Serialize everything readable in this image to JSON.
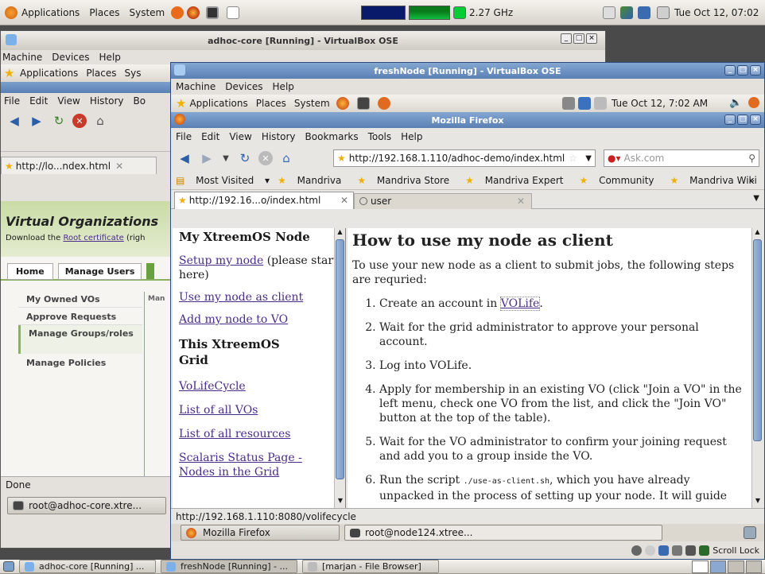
{
  "top_panel": {
    "applications": "Applications",
    "places": "Places",
    "system": "System",
    "cpu_freq": "2.27 GHz",
    "clock": "Tue Oct 12, 07:02"
  },
  "back_window": {
    "title": "adhoc-core [Running] - VirtualBox OSE",
    "menu": [
      "Machine",
      "Devices",
      "Help"
    ],
    "guest_panel": {
      "applications": "Applications",
      "places": "Places",
      "system": "Sys"
    },
    "ff_menu": [
      "File",
      "Edit",
      "View",
      "History",
      "Bo"
    ],
    "tab_label": "http://lo...ndex.html",
    "heading": "Virtual Organizations",
    "download_text": "Download the ",
    "root_cert_link": "Root certificate",
    "download_suffix": " (righ",
    "tabs": [
      "Home",
      "Manage Users"
    ],
    "sidebar": [
      "My Owned VOs",
      "Approve Requests",
      "Manage Groups/roles",
      "Manage Policies"
    ],
    "col_header": "Man",
    "status": "Done",
    "terminal_task": "root@adhoc-core.xtre..."
  },
  "front_window": {
    "title": "freshNode [Running] - VirtualBox OSE",
    "menu": [
      "Machine",
      "Devices",
      "Help"
    ],
    "guest_panel": {
      "applications": "Applications",
      "places": "Places",
      "system": "System",
      "clock": "Tue Oct 12,  7:02 AM"
    },
    "firefox": {
      "title": "Mozilla Firefox",
      "menu": [
        "File",
        "Edit",
        "View",
        "History",
        "Bookmarks",
        "Tools",
        "Help"
      ],
      "url": "http://192.168.1.110/adhoc-demo/index.html",
      "search_placeholder": "Ask.com",
      "bookmarks": [
        "Most Visited",
        "Mandriva",
        "Mandriva Store",
        "Mandriva Expert",
        "Community",
        "Mandriva Wiki"
      ],
      "more": "»",
      "tabs": [
        "http://192.16...o/index.html",
        "user"
      ],
      "status_url": "http://192.168.1.110:8080/volifecycle"
    },
    "left_frame": {
      "heading": "My XtreemOS Node",
      "links": [
        {
          "link": "Setup my node",
          "suffix": " (please start here)"
        },
        {
          "link": "Use my node as client",
          "suffix": ""
        },
        {
          "link": "Add my node to VO",
          "suffix": ""
        }
      ],
      "heading2": "This XtreemOS Grid",
      "links2": [
        "VoLifeCycle",
        "List of all VOs",
        "List of all resources",
        "Scalaris Status Page - Nodes in the Grid"
      ]
    },
    "content": {
      "heading": "How to use my node as client",
      "intro": "To use your new node as a client to submit jobs, the following steps are requried:",
      "steps": [
        {
          "pre": "Create an account in ",
          "link": "VOLife",
          "post": "."
        },
        {
          "pre": "Wait for the grid administrator to approve your personal account.",
          "link": "",
          "post": ""
        },
        {
          "pre": "Log into VOLife.",
          "link": "",
          "post": ""
        },
        {
          "pre": "Apply for membership in an existing VO (click \"Join a VO\" in the left menu, check one VO from the list, and click the \"Join VO\" button at the top of the table).",
          "link": "",
          "post": ""
        },
        {
          "pre": "Wait for the VO administrator to confirm your joining request and add you to a group inside the VO.",
          "link": "",
          "post": ""
        },
        {
          "pre": "Run the script ",
          "code": "./use-as-client.sh",
          "post": ", which you have already unpacked in the process of setting up your node. It will guide"
        }
      ]
    },
    "guest_taskbar": [
      "Mozilla Firefox",
      "root@node124.xtree..."
    ],
    "guest_tray": {
      "scroll_lock": "Scroll Lock"
    }
  },
  "bottom_taskbar": [
    "adhoc-core [Running] ...",
    "freshNode [Running] - ...",
    "[marjan - File Browser]"
  ],
  "colors": {
    "accent_title": "#6b8fc2",
    "link": "#4b2c8b",
    "panel": "#e4e1dc"
  }
}
